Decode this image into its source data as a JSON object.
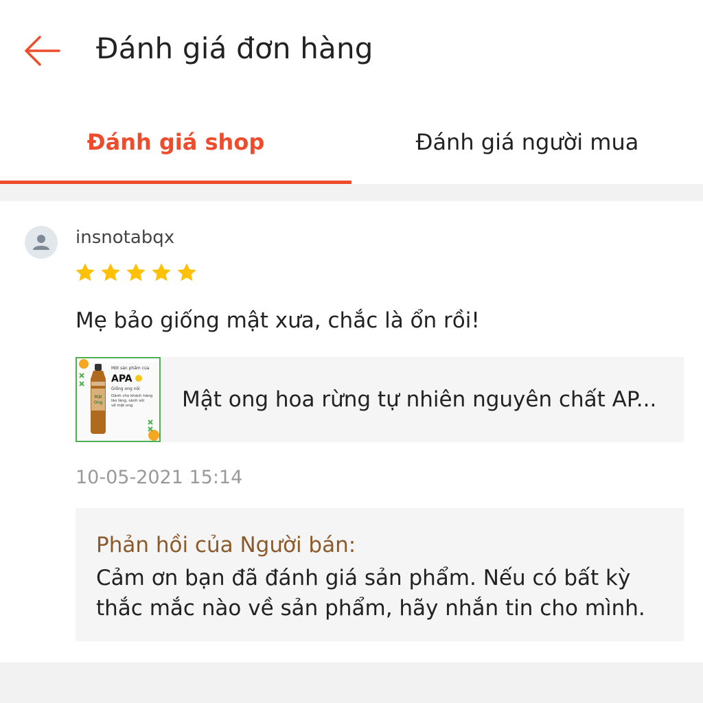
{
  "header": {
    "title": "Đánh giá đơn hàng",
    "back_icon": "arrow-left-icon",
    "accent_color": "#ee4d2d"
  },
  "tabs": [
    {
      "label": "Đánh giá shop",
      "active": true
    },
    {
      "label": "Đánh giá người mua",
      "active": false
    }
  ],
  "review": {
    "username": "insnotabqx",
    "avatar_icon": "user-icon",
    "rating": 5,
    "rating_max": 5,
    "star_color": "#ffc107",
    "comment": "Mẹ bảo giống mật xưa, chắc là ổn rồi!",
    "product": {
      "name": "Mật ong hoa rừng tự nhiên nguyên chất AP...",
      "image": {
        "line1": "Một sản phẩm của",
        "brand": "APA",
        "line2": "Giống ong nội",
        "line3": "Dành cho khách hàng",
        "line4": "lão làng, sành sỏi",
        "line5": "về mật ong"
      }
    },
    "timestamp": "10-05-2021 15:14",
    "seller_reply": {
      "title": "Phản hồi của Người bán:",
      "body": "Cảm ơn bạn đã đánh giá sản phẩm. Nếu có bất kỳ thắc mắc nào về sản phẩm, hãy nhắn tin cho mình."
    }
  }
}
